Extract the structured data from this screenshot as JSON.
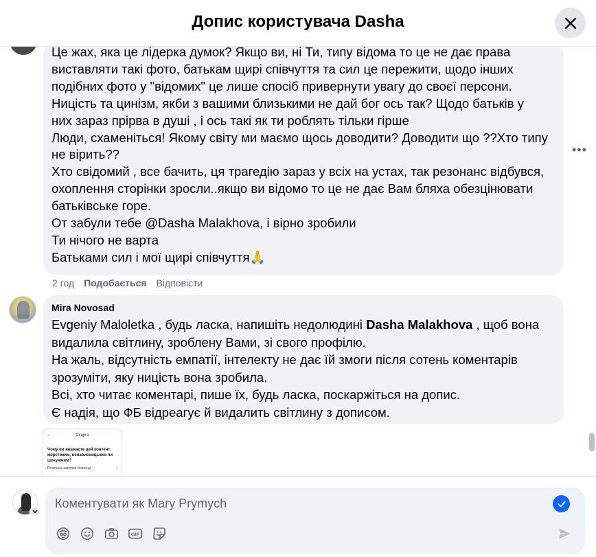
{
  "header": {
    "title": "Допис користувача Dasha"
  },
  "icons": {
    "close": "close-icon",
    "more": "more-icon",
    "verified": "check-icon",
    "send": "send-icon",
    "tools": [
      "avatar-sticker-icon",
      "emoji-icon",
      "camera-icon",
      "gif-icon",
      "sticker-icon"
    ]
  },
  "comment1": {
    "lines": [
      "Це жах, яка це лідерка думок? Якщо ви, ні Ти, типу відома то це не дає права",
      "виставляти такі фото, батькам щирі співчуття та сил це пережити, щодо інших",
      "подібних фото у \"відомих\" це лише спосіб привернути увагу до своєї персони.",
      "Ницість та цинізм, якби з вашими близькими не дай бог ось так? Щодо батьків у",
      "них зараз прірва в душі , і ось такі як ти роблять тільки гірше",
      "Люди, схаменіться! Якому світу ми маємо щось доводити? Доводити що ??Хто типу",
      "не вірить??",
      "Хто свідомий , все бачить, ця трагедію зараз у всіх на устах, так резонанс відбувся,",
      "охоплення сторінки зросли..якщо ви відомо то це не дає Вам бляха обезцінювати",
      "батьківське горе.",
      "От забули тебе @Dasha Malakhova, і вірно зробили",
      "Ти нічого не варта",
      "Батьками сил і мої щирі співчуття🙏"
    ],
    "time": "2 год",
    "like_label": "Подобається",
    "reply_label": "Відповісти"
  },
  "comment2": {
    "author": "Mira Novosad",
    "line1": {
      "mention1": "Evgeniy Maloletka",
      "mid": " , будь ласка, напишіть недолюдині ",
      "mention2": "Dasha Malakhova",
      "end": " , щоб вона"
    },
    "lines": [
      "видалила світлину, зроблену Вами, зі свого профілю.",
      "На жаль, відсутність емпатії, інтелекту не дає їй змоги після сотень коментарів",
      "зрозуміти, яку ницість вона зробила.",
      "Всі, хто читає коментарі, пише їх, будь ласка, поскаржіться на допис.",
      "Є надія, що ФБ відреагує й видалить світлину з дописом."
    ]
  },
  "attachment": {
    "title": "Скарга",
    "question": "Чому ви вважаєте цей контент жорстоким, ненависницьким чи шокуючим?",
    "option": "Реальна загроза безпеці"
  },
  "composer": {
    "placeholder": "Коментувати як Mary Prymych"
  },
  "colors": {
    "bubble": "#f0f2f5",
    "accent": "#0866ff",
    "secondary_text": "#65676b"
  }
}
